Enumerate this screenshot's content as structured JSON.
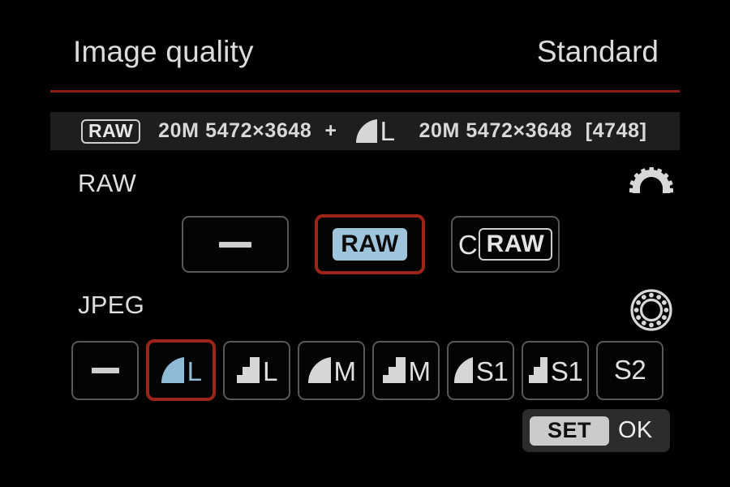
{
  "header": {
    "title": "Image quality",
    "mode": "Standard",
    "accent_underline_color": "#8e1c16"
  },
  "info_bar": {
    "raw_badge": "RAW",
    "raw_spec": "20M 5472×3648",
    "plus": "+",
    "jpeg_quality_letter": "L",
    "jpeg_spec": "20M 5472×3648",
    "remaining_shots": "[4748]"
  },
  "raw_section": {
    "label": "RAW",
    "dial_icon": "main-dial-icon",
    "options": [
      {
        "id": "raw-none",
        "label": "—",
        "kind": "dash",
        "selected": false
      },
      {
        "id": "raw",
        "label": "RAW",
        "kind": "raw-filled",
        "selected": true
      },
      {
        "id": "craw",
        "label": "CRAW",
        "prefix": "C",
        "badge": "RAW",
        "kind": "craw",
        "selected": false
      }
    ]
  },
  "jpeg_section": {
    "label": "JPEG",
    "dial_icon": "quick-control-dial-icon",
    "options": [
      {
        "id": "jpeg-none",
        "label": "—",
        "quality": "",
        "icon": "dash",
        "selected": false
      },
      {
        "id": "jpeg-fine-l",
        "label": "L",
        "quality": "fine",
        "icon": "smooth-arc",
        "selected": true
      },
      {
        "id": "jpeg-normal-l",
        "label": "L",
        "quality": "normal",
        "icon": "stair-step",
        "selected": false
      },
      {
        "id": "jpeg-fine-m",
        "label": "M",
        "quality": "fine",
        "icon": "smooth-arc",
        "selected": false
      },
      {
        "id": "jpeg-normal-m",
        "label": "M",
        "quality": "normal",
        "icon": "stair-step",
        "selected": false
      },
      {
        "id": "jpeg-fine-s1",
        "label": "S1",
        "quality": "fine",
        "icon": "smooth-arc",
        "selected": false
      },
      {
        "id": "jpeg-normal-s1",
        "label": "S1",
        "quality": "normal",
        "icon": "stair-step",
        "selected": false
      },
      {
        "id": "jpeg-s2",
        "label": "S2",
        "quality": "",
        "icon": "none",
        "selected": false
      }
    ]
  },
  "footer": {
    "set_label": "SET",
    "ok_label": "OK"
  },
  "colors": {
    "background": "#010101",
    "selection_red": "#9d2418",
    "header_rule_red": "#8e1c16",
    "selected_icon_blue": "#8fbbd6",
    "raw_chip_blue": "#9fc5dd",
    "text_primary": "#dedede",
    "button_border": "#585858",
    "info_bar_bg": "#1e1e1e",
    "footer_bg": "#2c2c2c",
    "set_badge_bg": "#cbcbcb"
  }
}
